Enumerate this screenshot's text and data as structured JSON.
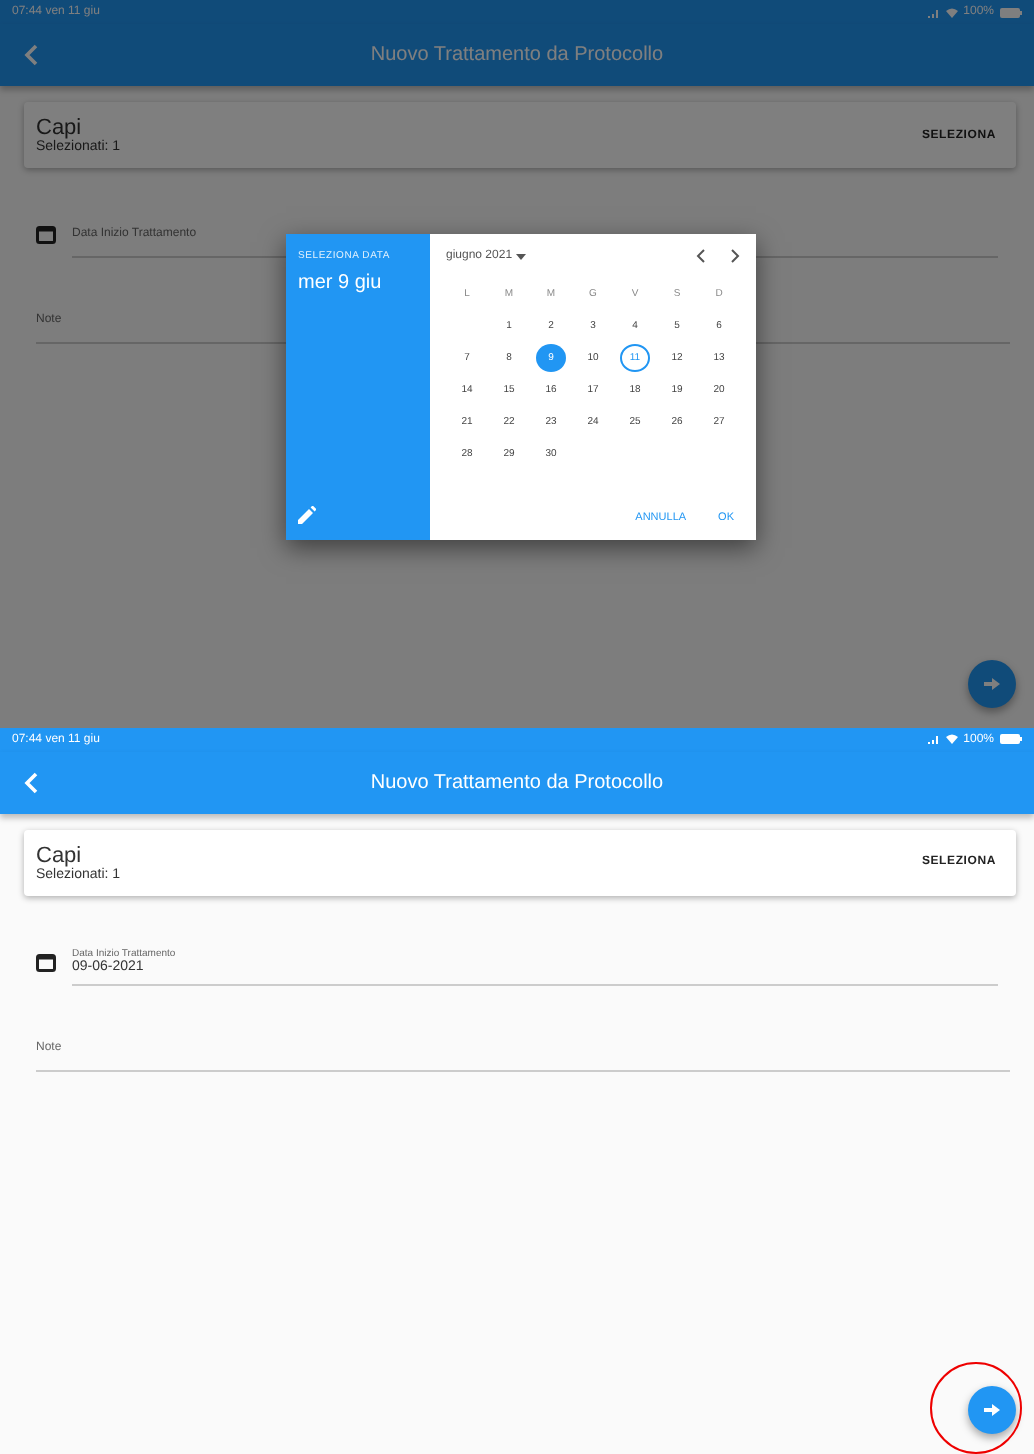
{
  "screens": [
    {
      "dimmed": true,
      "status_bar": {
        "time": "07:44",
        "date": "ven 11 giu",
        "battery": "100%"
      },
      "app_bar": {
        "title": "Nuovo Trattamento da Protocollo"
      },
      "capi_card": {
        "title": "Capi",
        "subtitle": "Selezionati: 1",
        "button": "SELEZIONA"
      },
      "date_field": {
        "placeholder": "Data Inizio Trattamento"
      },
      "notes_field": {
        "placeholder": "Note"
      },
      "fab": {
        "highlighted": false
      },
      "dialog": {
        "header_label": "SELEZIONA DATA",
        "selected_date": "mer 9 giu",
        "month": "giugno 2021",
        "weekdays": [
          "L",
          "M",
          "M",
          "G",
          "V",
          "S",
          "D"
        ],
        "weeks": [
          {
            "kind": "partial-start",
            "days": [
              {
                "label": "1",
                "selected": false,
                "today": false
              },
              {
                "label": "2",
                "selected": false,
                "today": false
              },
              {
                "label": "3",
                "selected": false,
                "today": false
              },
              {
                "label": "4",
                "selected": false,
                "today": false
              },
              {
                "label": "5",
                "selected": false,
                "today": false
              },
              {
                "label": "6",
                "selected": false,
                "today": false
              }
            ]
          },
          {
            "kind": "full",
            "days": [
              {
                "label": "7",
                "selected": false,
                "today": false
              },
              {
                "label": "8",
                "selected": false,
                "today": false
              },
              {
                "label": "9",
                "selected": true,
                "today": false
              },
              {
                "label": "10",
                "selected": false,
                "today": false
              },
              {
                "label": "11",
                "selected": false,
                "today": true
              },
              {
                "label": "12",
                "selected": false,
                "today": false
              },
              {
                "label": "13",
                "selected": false,
                "today": false
              }
            ]
          },
          {
            "kind": "full",
            "days": [
              {
                "label": "14",
                "selected": false,
                "today": false
              },
              {
                "label": "15",
                "selected": false,
                "today": false
              },
              {
                "label": "16",
                "selected": false,
                "today": false
              },
              {
                "label": "17",
                "selected": false,
                "today": false
              },
              {
                "label": "18",
                "selected": false,
                "today": false
              },
              {
                "label": "19",
                "selected": false,
                "today": false
              },
              {
                "label": "20",
                "selected": false,
                "today": false
              }
            ]
          },
          {
            "kind": "full",
            "days": [
              {
                "label": "21",
                "selected": false,
                "today": false
              },
              {
                "label": "22",
                "selected": false,
                "today": false
              },
              {
                "label": "23",
                "selected": false,
                "today": false
              },
              {
                "label": "24",
                "selected": false,
                "today": false
              },
              {
                "label": "25",
                "selected": false,
                "today": false
              },
              {
                "label": "26",
                "selected": false,
                "today": false
              },
              {
                "label": "27",
                "selected": false,
                "today": false
              }
            ]
          },
          {
            "kind": "partial-end",
            "days": [
              {
                "label": "28",
                "selected": false,
                "today": false
              },
              {
                "label": "29",
                "selected": false,
                "today": false
              },
              {
                "label": "30",
                "selected": false,
                "today": false
              }
            ]
          }
        ],
        "buttons": [
          "ANNULLA",
          "OK"
        ]
      }
    },
    {
      "dimmed": false,
      "status_bar": {
        "time": "07:44",
        "date": "ven 11 giu",
        "battery": "100%"
      },
      "app_bar": {
        "title": "Nuovo Trattamento da Protocollo"
      },
      "capi_card": {
        "title": "Capi",
        "subtitle": "Selezionati: 1",
        "button": "SELEZIONA"
      },
      "date_field": {
        "label": "Data Inizio Trattamento",
        "value": "09-06-2021"
      },
      "notes_field": {
        "placeholder": "Note"
      },
      "fab": {
        "highlighted": true
      }
    }
  ]
}
